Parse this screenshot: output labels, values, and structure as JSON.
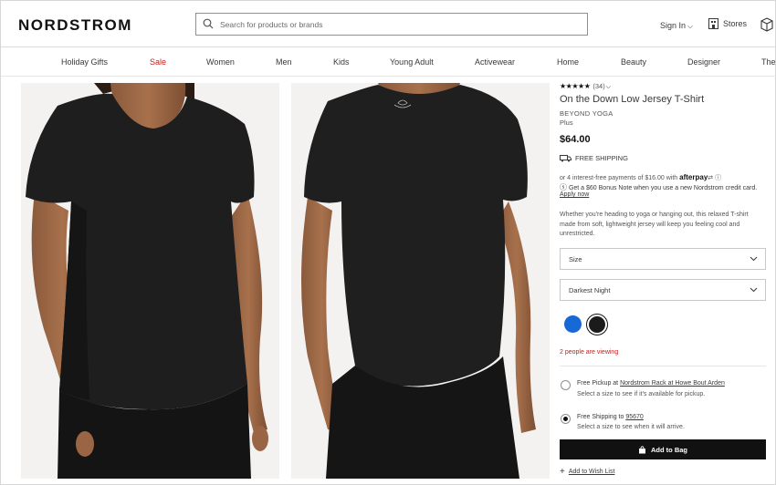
{
  "header": {
    "logo": "NORDSTROM",
    "search_placeholder": "Search for products or brands",
    "sign_in": "Sign In",
    "stores": "Stores"
  },
  "nav": {
    "items": [
      "Holiday Gifts",
      "Sale",
      "Women",
      "Men",
      "Kids",
      "Young Adult",
      "Activewear",
      "Home",
      "Beauty",
      "Designer",
      "The"
    ]
  },
  "product": {
    "stars": "★★★★★",
    "rating_count": "(34)",
    "title": "On the Down Low Jersey T-Shirt",
    "brand": "BEYOND YOGA",
    "fit": "Plus",
    "price": "$64.00",
    "free_shipping": "FREE SHIPPING",
    "afterpay_text": "or 4 interest-free payments of $16.00 with",
    "afterpay_brand": "afterpay",
    "bonus_note": "Get a $60 Bonus Note when you use a new Nordstrom credit card.",
    "apply_now": "Apply now",
    "description": "Whether you're heading to yoga or hanging out, this relaxed T-shirt made from soft, lightweight jersey will keep you feeling cool and unrestricted.",
    "size_label": "Size",
    "color_label": "Darkest Night",
    "swatch_colors": [
      "#1769d6",
      "#1b1b1b"
    ],
    "viewing": "2 people are viewing"
  },
  "fulfillment": {
    "pickup_prefix": "Free Pickup at ",
    "pickup_store": "Nordstrom Rack at Howe Bout Arden",
    "pickup_sub": "Select a size to see if it's available for pickup.",
    "shipping_prefix": "Free Shipping to ",
    "shipping_zip": "95670",
    "shipping_sub": "Select a size to see when it will arrive.",
    "selected": "shipping"
  },
  "actions": {
    "add_to_bag": "Add to Bag",
    "wish_list": "Add to Wish List"
  },
  "colors": {
    "sale": "#c0211f",
    "button": "#111111"
  }
}
